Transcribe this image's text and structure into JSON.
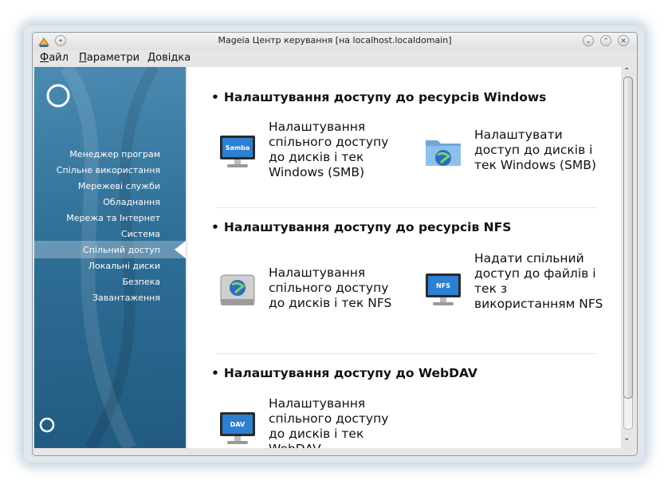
{
  "window": {
    "title": "Mageia Центр керування  [на localhost.localdomain]"
  },
  "menubar": {
    "items": [
      {
        "label": "Файл",
        "accel": "Ф",
        "rest": "айл"
      },
      {
        "label": "Параметри",
        "accel": "П",
        "rest": "араметри"
      },
      {
        "label": "Довідка",
        "accel": "Д",
        "rest": "овідка"
      }
    ]
  },
  "sidebar": {
    "items": [
      {
        "label": "Менеджер програм"
      },
      {
        "label": "Спільне використання"
      },
      {
        "label": "Мережеві служби"
      },
      {
        "label": "Обладнання"
      },
      {
        "label": "Мережа та Інтернет"
      },
      {
        "label": "Система"
      },
      {
        "label": "Спільний доступ"
      },
      {
        "label": "Локальні диски"
      },
      {
        "label": "Безпека"
      },
      {
        "label": "Завантаження"
      }
    ],
    "selected": "Спільний доступ"
  },
  "sections": [
    {
      "title": "Налаштування доступу до ресурсів Windows",
      "tools": [
        {
          "label": "Налаштування спільного доступу до дисків і тек Windows (SMB)",
          "icon": "samba-monitor-icon",
          "icon_text": "Samba"
        },
        {
          "label": "Налаштувати доступ до дисків і тек Windows (SMB)",
          "icon": "network-folder-icon"
        }
      ]
    },
    {
      "title": "Налаштування доступу до ресурсів NFS",
      "tools": [
        {
          "label": "Налаштування спільного доступу до дисків і тек NFS",
          "icon": "network-drive-icon"
        },
        {
          "label": "Надати спільний доступ до файлів і тек з використанням NFS",
          "icon": "nfs-monitor-icon",
          "icon_text": "NFS"
        }
      ]
    },
    {
      "title": "Налаштування доступу до WebDAV",
      "tools": [
        {
          "label": "Налаштування спільного доступу до дисків і тек WebDAV",
          "icon": "dav-monitor-icon",
          "icon_text": "DAV"
        }
      ]
    }
  ],
  "colors": {
    "sidebar": "#2f6f97",
    "selection": "#ffffff",
    "window_frame": "#e6e6e6"
  }
}
